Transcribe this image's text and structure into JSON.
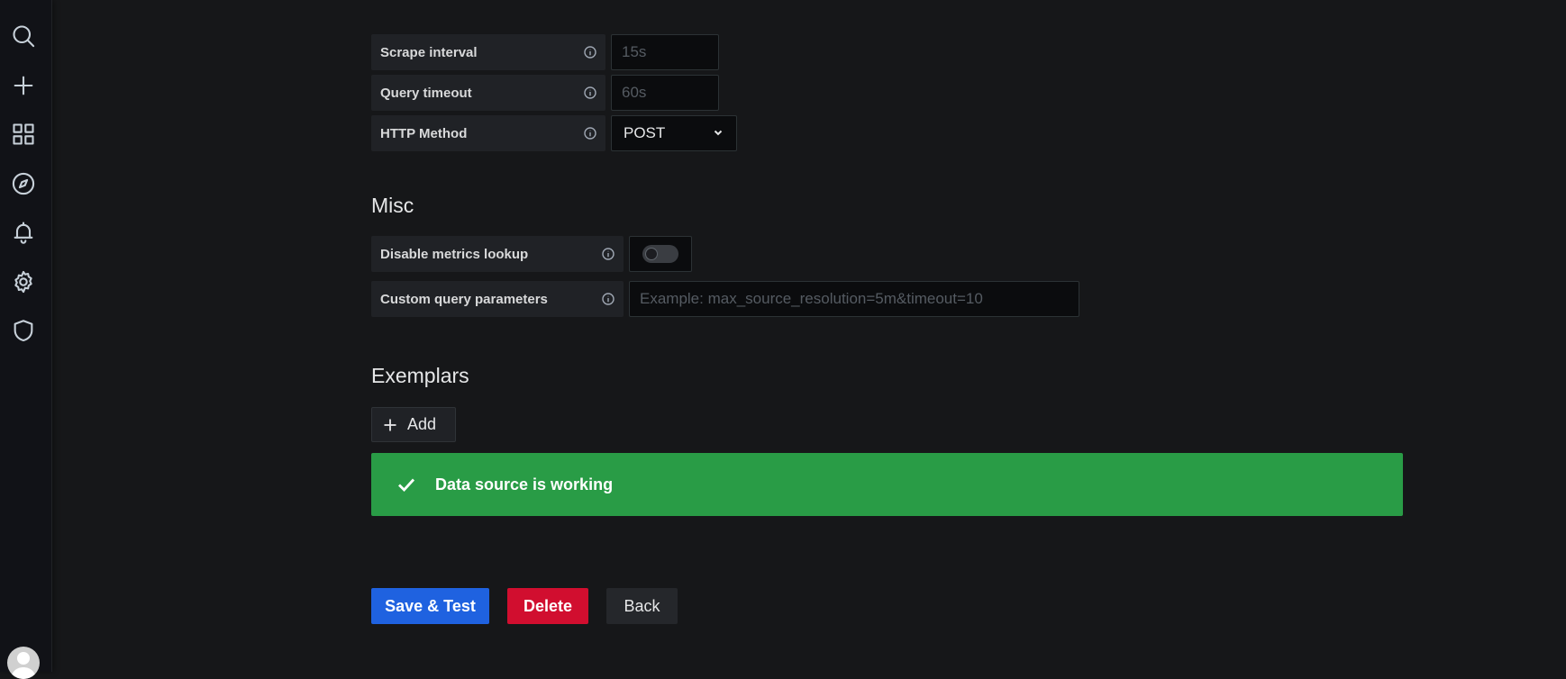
{
  "sidebar": {
    "icons": [
      {
        "name": "search-icon"
      },
      {
        "name": "plus-icon"
      },
      {
        "name": "dashboards-icon"
      },
      {
        "name": "compass-icon"
      },
      {
        "name": "bell-icon"
      },
      {
        "name": "gear-icon"
      },
      {
        "name": "shield-icon"
      }
    ]
  },
  "http": {
    "scrape_interval": {
      "label": "Scrape interval",
      "placeholder": "15s",
      "value": ""
    },
    "query_timeout": {
      "label": "Query timeout",
      "placeholder": "60s",
      "value": ""
    },
    "http_method": {
      "label": "HTTP Method",
      "value": "POST"
    }
  },
  "misc": {
    "title": "Misc",
    "disable_metrics_lookup": {
      "label": "Disable metrics lookup",
      "enabled": false
    },
    "custom_query_parameters": {
      "label": "Custom query parameters",
      "placeholder": "Example: max_source_resolution=5m&timeout=10",
      "value": ""
    }
  },
  "exemplars": {
    "title": "Exemplars",
    "add_label": "Add"
  },
  "alert": {
    "message": "Data source is working",
    "color": "#299c46"
  },
  "actions": {
    "save_label": "Save & Test",
    "delete_label": "Delete",
    "back_label": "Back"
  },
  "colors": {
    "background": "#161719",
    "primary": "#1f62e0",
    "destructive": "#d10e2f",
    "success": "#299c46"
  }
}
